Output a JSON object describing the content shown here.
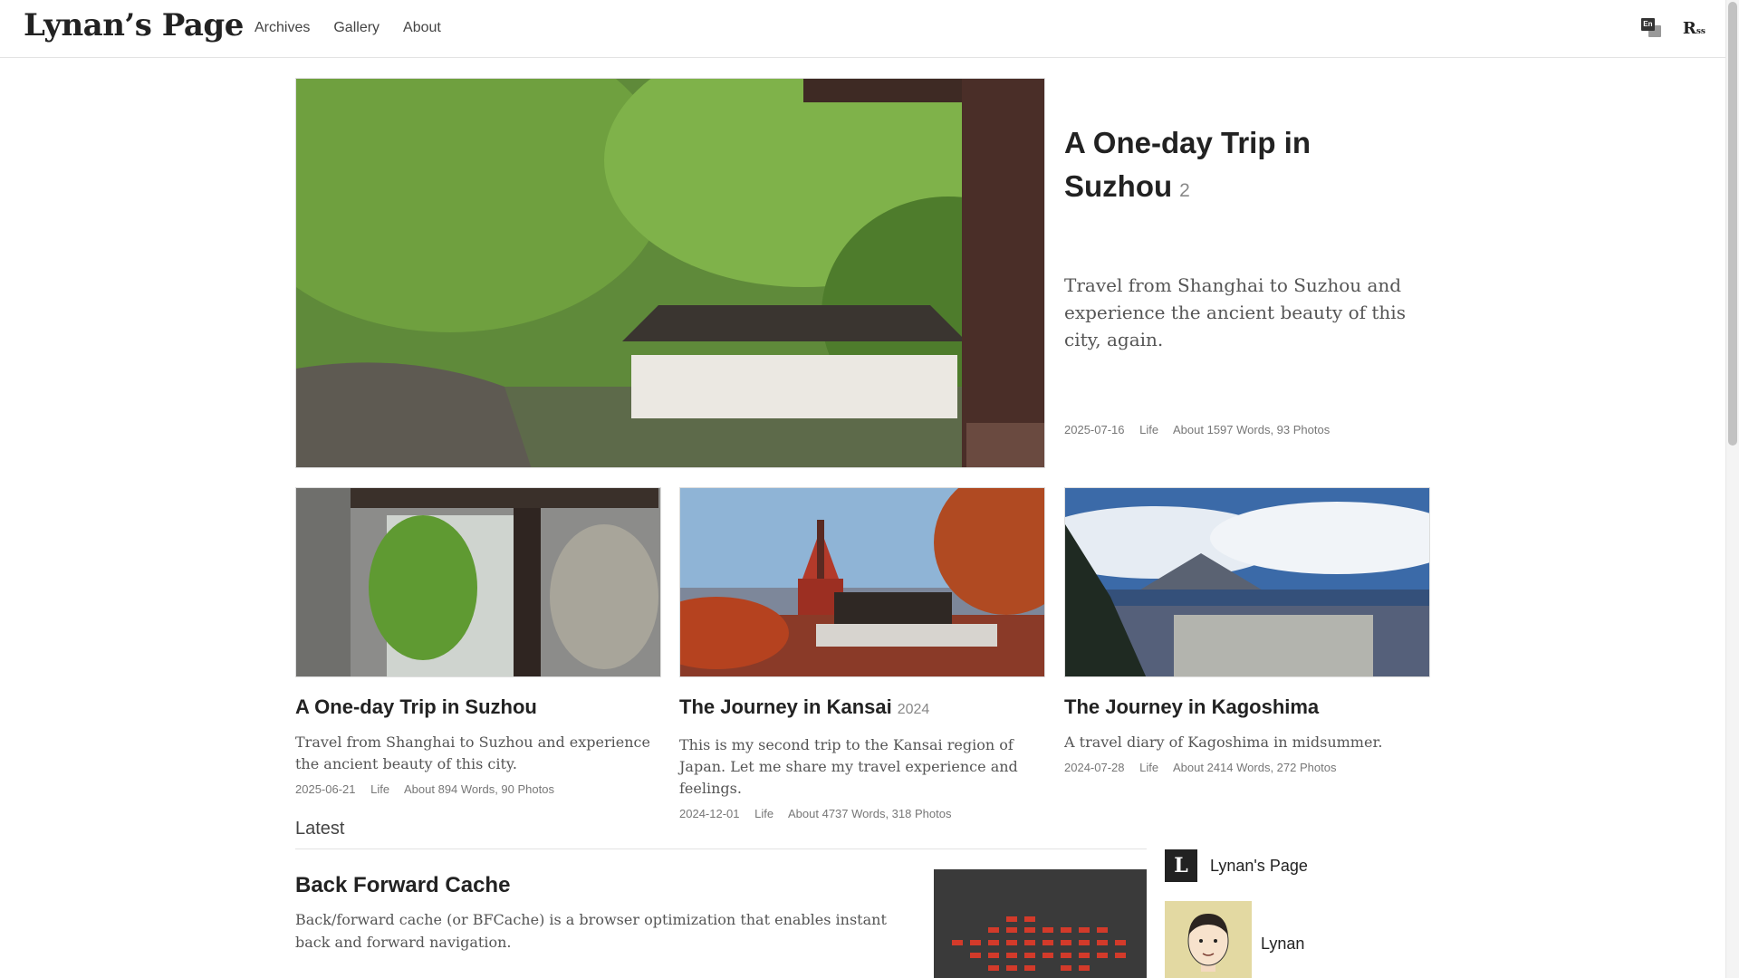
{
  "header": {
    "logo": "Lynan’s Page",
    "nav": [
      "Archives",
      "Gallery",
      "About"
    ],
    "lang_icon_text": "En",
    "rss_icon": {
      "r": "R",
      "ss": "ss"
    }
  },
  "featured": {
    "title": "A One-day Trip in Suzhou",
    "count": "2",
    "description": "Travel from Shanghai to Suzhou and experience the ancient beauty of this city, again.",
    "date": "2025-07-16",
    "category": "Life",
    "stats": "About 1597 Words, 93 Photos"
  },
  "cards": [
    {
      "title": "A One-day Trip in Suzhou",
      "year": "",
      "description": "Travel from Shanghai to Suzhou and experience the ancient beauty of this city.",
      "date": "2025-06-21",
      "category": "Life",
      "stats": "About 894 Words, 90 Photos"
    },
    {
      "title": "The Journey in Kansai",
      "year": "2024",
      "description": "This is my second trip to the Kansai region of Japan. Let me share my travel experience and feelings.",
      "date": "2024-12-01",
      "category": "Life",
      "stats": "About 4737 Words, 318 Photos"
    },
    {
      "title": "The Journey in Kagoshima",
      "year": "",
      "description": "A travel diary of Kagoshima in midsummer.",
      "date": "2024-07-28",
      "category": "Life",
      "stats": "About 2414 Words, 272 Photos"
    }
  ],
  "latest": {
    "heading": "Latest",
    "post": {
      "title": "Back Forward Cache",
      "description": "Back/forward cache (or BFCache) is a browser optimization that enables instant back and forward navigation."
    }
  },
  "sidebar": {
    "logo_letter": "L",
    "brand": "Lynan's Page",
    "author": "Lynan"
  },
  "colors": {
    "text": "#222222",
    "muted": "#777777",
    "border": "#e3e3e3"
  }
}
